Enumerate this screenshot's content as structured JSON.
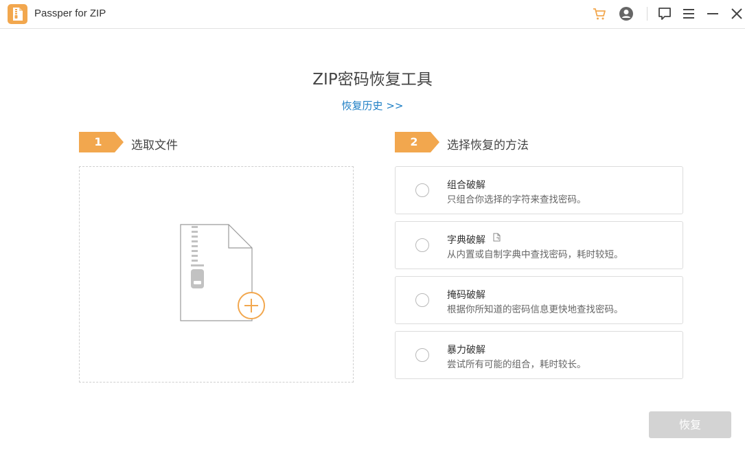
{
  "app": {
    "title": "Passper for ZIP",
    "accent_color": "#f2a74e"
  },
  "titlebar": {
    "icons": [
      "cart-icon",
      "account-icon",
      "feedback-icon",
      "menu-icon",
      "minimize-icon",
      "close-icon"
    ]
  },
  "main": {
    "title": "ZIP密码恢复工具",
    "history_link": "恢复历史 >>"
  },
  "step1": {
    "number": "1",
    "label": "选取文件",
    "drop_zone_icon": "zip-file-add-icon"
  },
  "step2": {
    "number": "2",
    "label": "选择恢复的方法",
    "methods": [
      {
        "title": "组合破解",
        "desc": "只组合你选择的字符来查找密码。",
        "selected": false
      },
      {
        "title": "字典破解",
        "desc": "从内置或自制字典中查找密码，耗时较短。",
        "selected": false,
        "extra_icon": "dictionary-file-icon"
      },
      {
        "title": "掩码破解",
        "desc": "根据你所知道的密码信息更快地查找密码。",
        "selected": false
      },
      {
        "title": "暴力破解",
        "desc": "尝试所有可能的组合，耗时较长。",
        "selected": false
      }
    ]
  },
  "footer": {
    "recover_button": "恢复",
    "recover_enabled": false
  }
}
